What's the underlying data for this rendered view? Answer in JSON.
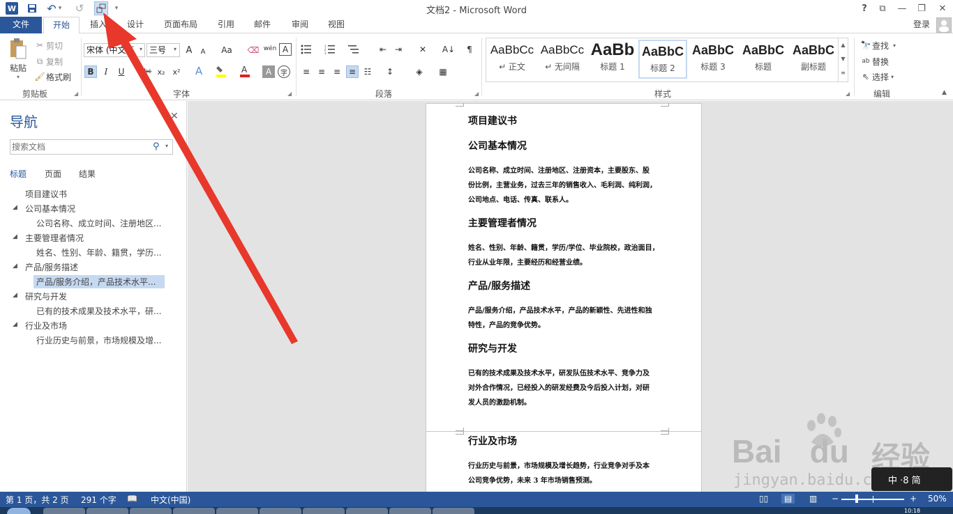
{
  "window": {
    "title": "文档2 - Microsoft Word",
    "help": "?",
    "minimize": "—",
    "restore": "❐",
    "close": "✕",
    "ribbon_display": "⧉"
  },
  "qat": {
    "undo": "↶",
    "redo": "↺",
    "dropdown": "▾"
  },
  "tabs": {
    "file": "文件",
    "home": "开始",
    "insert": "插入",
    "design": "设计",
    "layout": "页面布局",
    "references": "引用",
    "mailings": "邮件",
    "review": "审阅",
    "view": "视图"
  },
  "account": {
    "login": "登录"
  },
  "clipboard": {
    "paste": "粘贴",
    "cut": "剪切",
    "copy": "复制",
    "format_painter": "格式刷",
    "label": "剪贴板"
  },
  "font": {
    "name": "宋体 (中文正",
    "size": "三号",
    "label": "字体",
    "grow": "A",
    "shrink": "A",
    "case": "Aa",
    "bold": "B",
    "italic": "I",
    "underline": "U",
    "strike": "abc",
    "sub": "x₂",
    "sup": "x²",
    "wen": "wén",
    "border_a": "A"
  },
  "paragraph": {
    "label": "段落"
  },
  "styles": {
    "label": "样式",
    "items": [
      {
        "sample": "AaBbCc",
        "name": "↵ 正文"
      },
      {
        "sample": "AaBbCc",
        "name": "↵ 无间隔"
      },
      {
        "sample": "AaBb",
        "name": "标题 1"
      },
      {
        "sample": "AaBbC",
        "name": "标题 2"
      },
      {
        "sample": "AaBbC",
        "name": "标题 3"
      },
      {
        "sample": "AaBbC",
        "name": "标题"
      },
      {
        "sample": "AaBbC",
        "name": "副标题"
      }
    ]
  },
  "editing": {
    "find": "查找",
    "replace": "替换",
    "select": "选择",
    "label": "编辑"
  },
  "nav": {
    "title": "导航",
    "close": "✕",
    "search_placeholder": "搜索文档",
    "tabs": [
      "标题",
      "页面",
      "结果"
    ],
    "items": [
      {
        "label": "项目建议书",
        "level": 1,
        "expanded": false,
        "selected": false
      },
      {
        "label": "公司基本情况",
        "level": 1,
        "expanded": true,
        "selected": false
      },
      {
        "label": "公司名称、成立时间、注册地区...",
        "level": 2,
        "expanded": false,
        "selected": false
      },
      {
        "label": "主要管理者情况",
        "level": 1,
        "expanded": true,
        "selected": false
      },
      {
        "label": "姓名、性别、年龄、籍贯，学历...",
        "level": 2,
        "expanded": false,
        "selected": false
      },
      {
        "label": "产品/服务描述",
        "level": 1,
        "expanded": true,
        "selected": false
      },
      {
        "label": "产品/服务介绍，产品技术水平...",
        "level": 2,
        "expanded": false,
        "selected": true
      },
      {
        "label": "研究与开发",
        "level": 1,
        "expanded": true,
        "selected": false
      },
      {
        "label": "已有的技术成果及技术水平，研...",
        "level": 2,
        "expanded": false,
        "selected": false
      },
      {
        "label": "行业及市场",
        "level": 1,
        "expanded": true,
        "selected": false
      },
      {
        "label": "行业历史与前景，市场规模及增...",
        "level": 2,
        "expanded": false,
        "selected": false
      }
    ]
  },
  "document": {
    "page1": [
      {
        "type": "h",
        "text": "项目建议书"
      },
      {
        "type": "h",
        "text": "公司基本情况"
      },
      {
        "type": "p",
        "lines": [
          "公司名称、成立时间、注册地区、注册资本，主要股东、股",
          "份比例，主营业务，过去三年的销售收入、毛利润、纯利润，",
          "公司地点、电话、传真、联系人。"
        ]
      },
      {
        "type": "h",
        "text": "主要管理者情况"
      },
      {
        "type": "p",
        "lines": [
          "姓名、性别、年龄、籍贯，学历/学位、毕业院校，政治面目，",
          "行业从业年限，主要经历和经营业绩。"
        ]
      },
      {
        "type": "h",
        "text": "产品/服务描述"
      },
      {
        "type": "p",
        "lines": [
          "产品/服务介绍，产品技术水平，产品的新颖性、先进性和独",
          "特性，产品的竞争优势。"
        ]
      },
      {
        "type": "h",
        "text": "研究与开发"
      },
      {
        "type": "p",
        "lines": [
          "已有的技术成果及技术水平，研发队伍技术水平、竞争力及",
          "对外合作情况，已经投入的研发经费及今后投入计划，对研",
          "发人员的激励机制。"
        ]
      }
    ],
    "page2": [
      {
        "type": "h",
        "text": "行业及市场"
      },
      {
        "type": "p",
        "lines": [
          "行业历史与前景，市场规模及增长趋势，行业竞争对手及本",
          "公司竞争优势，未来 3 年市场销售预测。"
        ]
      }
    ]
  },
  "watermark": {
    "brand": "Bai",
    "brand2": "du",
    "cn": "经验",
    "url": "jingyan.baidu.com",
    "ime": "中 ·8 简"
  },
  "status": {
    "page": "第 1 页，共 2 页",
    "words": "291 个字",
    "lang": "中文(中国)",
    "zoom": "50%",
    "zoom_minus": "−",
    "zoom_plus": "+",
    "clock": "10:18"
  },
  "colors": {
    "accent": "#2b579a",
    "arrow": "#e8382b"
  }
}
